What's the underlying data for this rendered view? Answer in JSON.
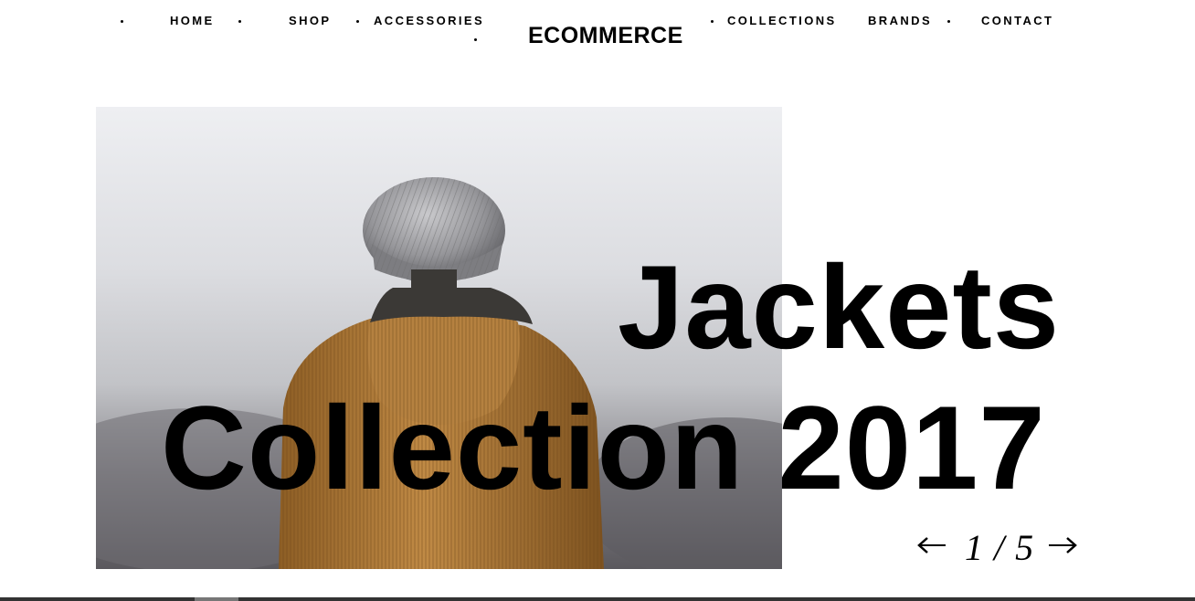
{
  "nav": {
    "items": [
      {
        "label": "HOME"
      },
      {
        "label": "SHOP"
      },
      {
        "label": "ACCESSORIES"
      },
      {
        "label": "COLLECTIONS"
      },
      {
        "label": "BRANDS"
      },
      {
        "label": "CONTACT"
      }
    ],
    "logo": "ECOMMERCE"
  },
  "hero": {
    "headline_line1": "Jackets",
    "headline_line2": "Collection 2017",
    "image_icon": "person-in-jacket-photo"
  },
  "slider": {
    "counter": "1 / 5",
    "prev_icon": "arrow-left-icon",
    "next_icon": "arrow-right-icon"
  },
  "colors": {
    "text": "#000000",
    "background": "#ffffff",
    "jacket": "#b07a35",
    "beanie": "#9a9a9e",
    "bottom_bar": "#333333"
  }
}
